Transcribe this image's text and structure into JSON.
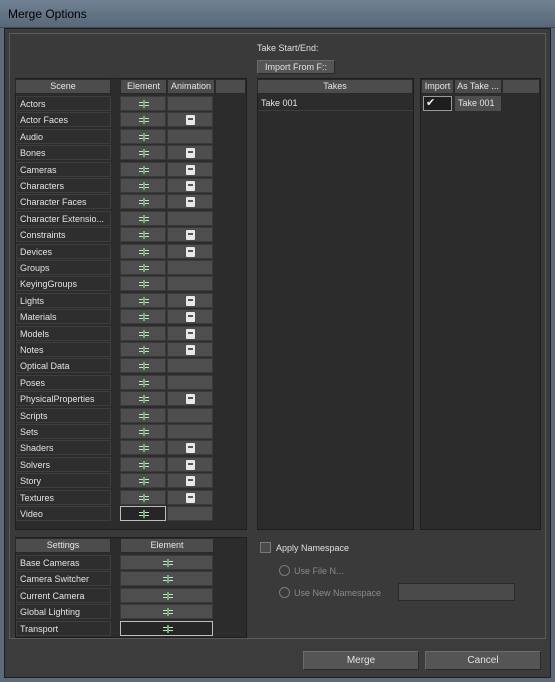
{
  "window": {
    "title": "Merge Options"
  },
  "take_start_end": {
    "label": "Take Start/End:",
    "button": "Import From F::"
  },
  "scene": {
    "header": "Scene",
    "col_element": "Element",
    "col_animation": "Animation",
    "rows": [
      {
        "label": "Actors",
        "anim": false
      },
      {
        "label": "Actor Faces",
        "anim": true
      },
      {
        "label": "Audio",
        "anim": false
      },
      {
        "label": "Bones",
        "anim": true
      },
      {
        "label": "Cameras",
        "anim": true
      },
      {
        "label": "Characters",
        "anim": true
      },
      {
        "label": "Character Faces",
        "anim": true
      },
      {
        "label": "Character Extensio...",
        "anim": false
      },
      {
        "label": "Constraints",
        "anim": true
      },
      {
        "label": "Devices",
        "anim": true
      },
      {
        "label": "Groups",
        "anim": false
      },
      {
        "label": "KeyingGroups",
        "anim": false
      },
      {
        "label": "Lights",
        "anim": true
      },
      {
        "label": "Materials",
        "anim": true
      },
      {
        "label": "Models",
        "anim": true
      },
      {
        "label": "Notes",
        "anim": true
      },
      {
        "label": "Optical Data",
        "anim": false
      },
      {
        "label": "Poses",
        "anim": false
      },
      {
        "label": "PhysicalProperties",
        "anim": true
      },
      {
        "label": "Scripts",
        "anim": false
      },
      {
        "label": "Sets",
        "anim": false
      },
      {
        "label": "Shaders",
        "anim": true
      },
      {
        "label": "Solvers",
        "anim": true
      },
      {
        "label": "Story",
        "anim": true
      },
      {
        "label": "Textures",
        "anim": true
      },
      {
        "label": "Video",
        "anim": false
      }
    ]
  },
  "settings": {
    "header": "Settings",
    "col_element": "Element",
    "rows": [
      "Base Cameras",
      "Camera Switcher",
      "Current Camera",
      "Global Lighting",
      "Transport"
    ]
  },
  "takes": {
    "header": "Takes",
    "col_import": "Import",
    "col_as_take": "As Take ...",
    "rows": [
      {
        "name": "Take 001",
        "import_checked": true,
        "as_take": "Take 001"
      }
    ]
  },
  "namespace": {
    "apply_label": "Apply Namespace",
    "use_file_label": "Use File N...",
    "use_new_label": "Use New Namespace",
    "new_value": ""
  },
  "buttons": {
    "merge": "Merge",
    "cancel": "Cancel"
  },
  "icons": {
    "element": "element-toggle-icon",
    "animation": "animation-toggle-icon",
    "checkbox": "checkmark-icon"
  }
}
